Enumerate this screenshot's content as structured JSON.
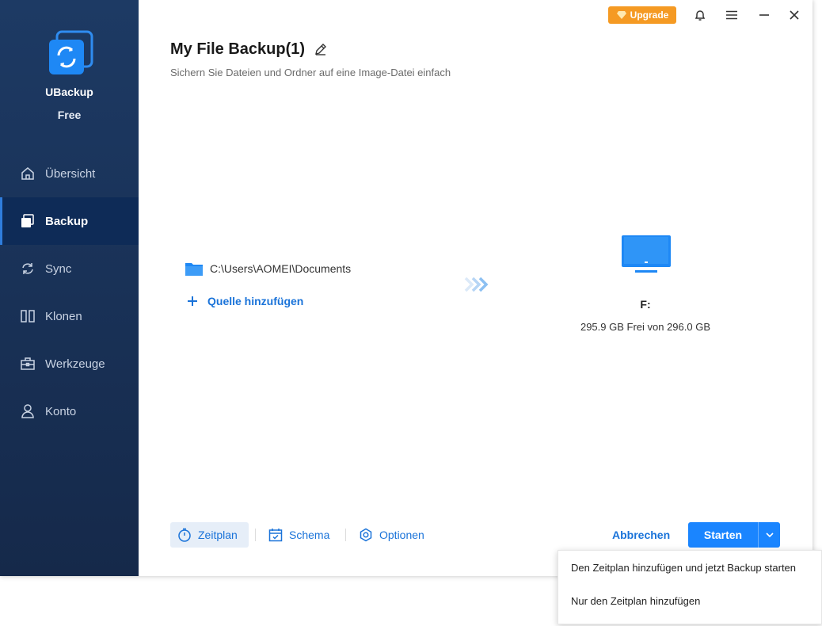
{
  "app": {
    "name": "UBackup",
    "edition": "Free"
  },
  "sidebar": {
    "items": [
      {
        "label": "Übersicht",
        "icon": "home-icon"
      },
      {
        "label": "Backup",
        "icon": "backup-icon",
        "active": true
      },
      {
        "label": "Sync",
        "icon": "sync-icon"
      },
      {
        "label": "Klonen",
        "icon": "clone-icon"
      },
      {
        "label": "Werkzeuge",
        "icon": "toolbox-icon"
      },
      {
        "label": "Konto",
        "icon": "user-icon"
      }
    ]
  },
  "titlebar": {
    "upgrade_label": "Upgrade"
  },
  "main": {
    "title": "My File Backup(1)",
    "subtitle": "Sichern Sie Dateien und Ordner auf eine Image-Datei einfach",
    "source_path": "C:\\Users\\AOMEI\\Documents",
    "add_source_label": "Quelle hinzufügen",
    "destination": {
      "drive": "F:",
      "space": "295.9 GB Frei von 296.0 GB"
    }
  },
  "toolbar": {
    "schedule_label": "Zeitplan",
    "scheme_label": "Schema",
    "options_label": "Optionen",
    "cancel_label": "Abbrechen",
    "start_label": "Starten"
  },
  "dropdown": {
    "items": [
      "Den Zeitplan hinzufügen und jetzt Backup starten",
      "Nur den Zeitplan hinzufügen"
    ]
  },
  "colors": {
    "accent": "#1a85ff",
    "sidebar": "#1d3a64",
    "upgrade": "#f59a23"
  }
}
